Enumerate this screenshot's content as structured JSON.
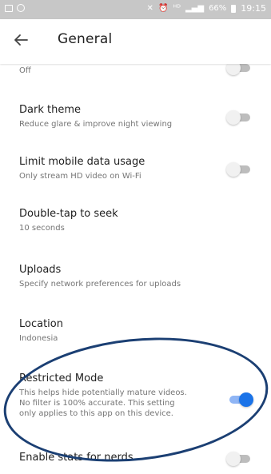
{
  "status_bar": {
    "icons": [
      "image-icon",
      "circle-icon",
      "mute-icon",
      "alarm-icon",
      "hd-icon",
      "signal-icon",
      "battery-icon"
    ],
    "battery": "66%",
    "time": "19:15"
  },
  "app_bar": {
    "title": "General"
  },
  "partial_row": {
    "subtitle": "Off",
    "toggle_on": false
  },
  "settings": [
    {
      "title": "Dark theme",
      "subtitle": "Reduce glare & improve night viewing",
      "toggle": false
    },
    {
      "title": "Limit mobile data usage",
      "subtitle": "Only stream HD video on Wi-Fi",
      "toggle": false
    },
    {
      "title": "Double-tap to seek",
      "subtitle": "10 seconds"
    },
    {
      "title": "Uploads",
      "subtitle": "Specify network preferences for uploads"
    },
    {
      "title": "Location",
      "subtitle": "Indonesia"
    },
    {
      "title": "Restricted Mode",
      "subtitle_lines": [
        "This helps hide potentially mature videos.",
        "No filter is 100% accurate. This setting",
        "only applies to this app on this device."
      ],
      "toggle": true
    },
    {
      "title": "Enable stats for nerds",
      "toggle": false
    }
  ],
  "colors": {
    "accent": "#1a73e8",
    "annotation": "#1b3f73",
    "status_bar": "#c7c7c7"
  }
}
